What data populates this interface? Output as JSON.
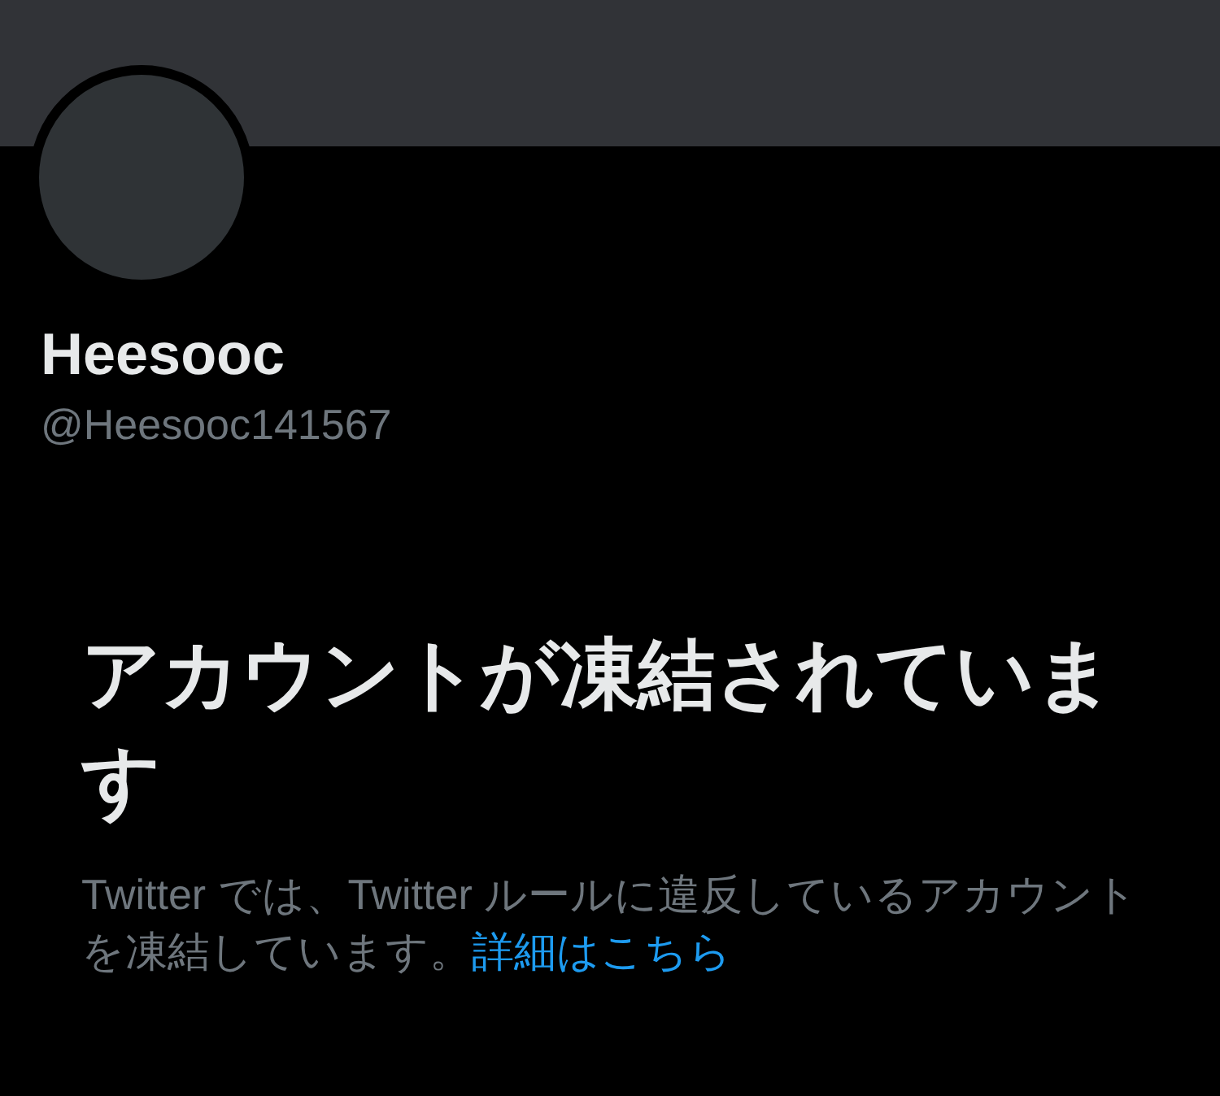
{
  "profile": {
    "name": "Heesooc",
    "handle": "@Heesooc141567"
  },
  "notice": {
    "title": "アカウントが凍結されています",
    "body": "Twitter では、Twitter ルールに違反しているアカウントを凍結しています。",
    "link": "詳細はこちら"
  }
}
